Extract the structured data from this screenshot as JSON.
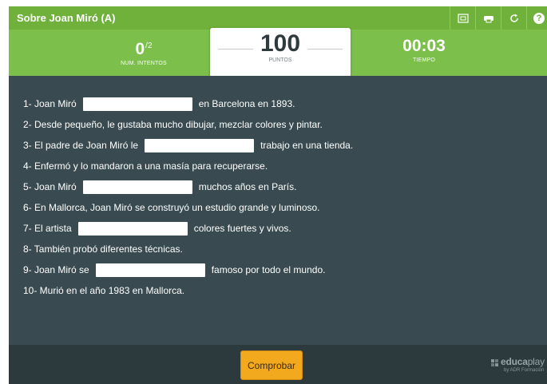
{
  "header": {
    "title": "Sobre Joan Miró (A)",
    "icons": [
      "fullscreen-icon",
      "print-icon",
      "restart-icon",
      "help-icon"
    ],
    "help_label": "?"
  },
  "stats": {
    "attempts_value": "0",
    "attempts_max": "/2",
    "attempts_label": "NUM. INTENTOS",
    "points_value": "100",
    "points_label": "PUNTOS",
    "time_value": "00:03",
    "time_label": "TIEMPO"
  },
  "sentences": [
    {
      "before": "1- Joan Miró",
      "has_gap": true,
      "gap_value": "",
      "after": "en Barcelona en 1893."
    },
    {
      "before": "2- Desde pequeño, le gustaba mucho dibujar, mezclar colores y pintar.",
      "has_gap": false
    },
    {
      "before": "3- El padre de Joan Miró le",
      "has_gap": true,
      "gap_value": "",
      "after": "trabajo en una tienda."
    },
    {
      "before": "4- Enfermó y lo mandaron a una masía para recuperarse.",
      "has_gap": false
    },
    {
      "before": "5- Joan Miró",
      "has_gap": true,
      "gap_value": "",
      "after": "muchos años en París."
    },
    {
      "before": "6- En Mallorca, Joan Miró se construyó un estudio grande y luminoso.",
      "has_gap": false
    },
    {
      "before": "7- El artista",
      "has_gap": true,
      "gap_value": "",
      "after": "colores fuertes y vivos."
    },
    {
      "before": "8- También probó diferentes técnicas.",
      "has_gap": false
    },
    {
      "before": "9- Joan Miró se",
      "has_gap": true,
      "gap_value": "",
      "after": "famoso por todo el mundo."
    },
    {
      "before": "10- Murió en el año 1983 en Mallorca.",
      "has_gap": false
    }
  ],
  "footer": {
    "check_label": "Comprobar",
    "brand_name_bold": "educa",
    "brand_name_light": "play",
    "brand_sub": "by ADR Formación"
  },
  "colors": {
    "title_bar": "#6fb13a",
    "score_bar": "#7cc04b",
    "main_bg": "#394b51",
    "footer_bg": "#2c3a3e",
    "accent_button": "#f3a91e"
  }
}
